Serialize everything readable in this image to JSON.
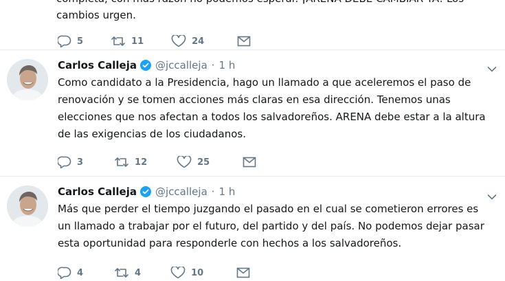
{
  "top_tweet": {
    "partial_text": "completa, con más razón no podemos esperar. ¡ARENA DEBE CAMBIAR YA! Los",
    "text_end": "cambios urgen.",
    "replies": "5",
    "retweets": "11",
    "likes": "24"
  },
  "tweets": [
    {
      "name": "Carlos Calleja",
      "handle": "@jccalleja",
      "separator": "·",
      "time": "1 h",
      "text": "Como candidato a la Presidencia, hago un llamado a que aceleremos el paso de renovación y se tomen acciones más claras en esa dirección. Tenemos unas elecciones que nos afectan a todos los salvadoreños. ARENA debe estar a la altura de las exigencias de los ciudadanos.",
      "replies": "3",
      "retweets": "12",
      "likes": "25"
    },
    {
      "name": "Carlos Calleja",
      "handle": "@jccalleja",
      "separator": "·",
      "time": "1 h",
      "text": "Más que perder el tiempo juzgando el pasado en el cual se cometieron errores es un llamado a trabajar por el futuro, del partido y del país. No podemos dejar pasar esta oportunidad para responderle con hechos a los salvadoreños.",
      "replies": "4",
      "retweets": "4",
      "likes": "10"
    }
  ],
  "icons": {
    "reply": "reply-icon",
    "retweet": "retweet-icon",
    "like": "heart-icon",
    "message": "envelope-icon",
    "verified": "verified-badge-icon",
    "caret": "chevron-down-icon"
  },
  "colors": {
    "accent": "#1da1f2",
    "muted": "#657786",
    "divider": "#e6ecf0"
  }
}
